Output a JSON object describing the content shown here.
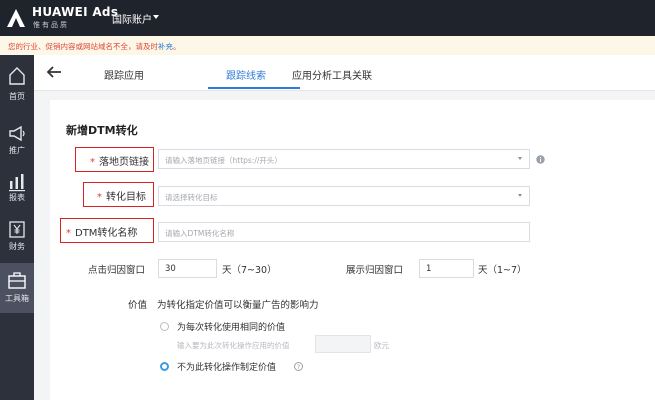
{
  "header": {
    "brand": "HUAWEI Ads",
    "brand_sub": "惟有品质",
    "account": "国际账户"
  },
  "notice": {
    "text": "您的行业、促销内容或网站域名不全，请及时",
    "link": "补充",
    "suffix": "。"
  },
  "sidebar": {
    "items": [
      {
        "label": "首页",
        "icon": "home-icon"
      },
      {
        "label": "推广",
        "icon": "megaphone-icon"
      },
      {
        "label": "报表",
        "icon": "chart-icon"
      },
      {
        "label": "财务",
        "icon": "yuan-icon"
      },
      {
        "label": "工具箱",
        "icon": "toolbox-icon"
      }
    ],
    "active_index": 4
  },
  "tabs": [
    {
      "label": "跟踪应用"
    },
    {
      "label": "跟踪线索"
    },
    {
      "label": "应用分析工具关联"
    }
  ],
  "form": {
    "title": "新增DTM转化",
    "landing_url": {
      "label": "落地页链接",
      "placeholder": "请输入落地页链接（https://开头）"
    },
    "conversion_goal": {
      "label": "转化目标",
      "placeholder": "请选择转化目标"
    },
    "dtm_name": {
      "label": "DTM转化名称",
      "placeholder": "请输入DTM转化名称"
    },
    "click_window": {
      "label": "点击归因窗口",
      "value": "30",
      "unit": "天（7~30）"
    },
    "view_window": {
      "label": "展示归因窗口",
      "value": "1",
      "unit": "天（1~7）"
    },
    "value": {
      "label": "价值",
      "description": "为转化指定价值可以衡量广告的影响力",
      "option_same": "为每次转化使用相同的价值",
      "hint_prefix": "输入要为此次转化操作应用的价值",
      "hint_suffix": "欧元",
      "option_none": "不为此转化操作制定价值",
      "selected": "none"
    }
  },
  "colors": {
    "accent": "#2f7ad8",
    "required": "#e23b3b",
    "highlight_box": "#d92323",
    "topbar": "#1f232c",
    "sidebar": "#2c313b"
  }
}
